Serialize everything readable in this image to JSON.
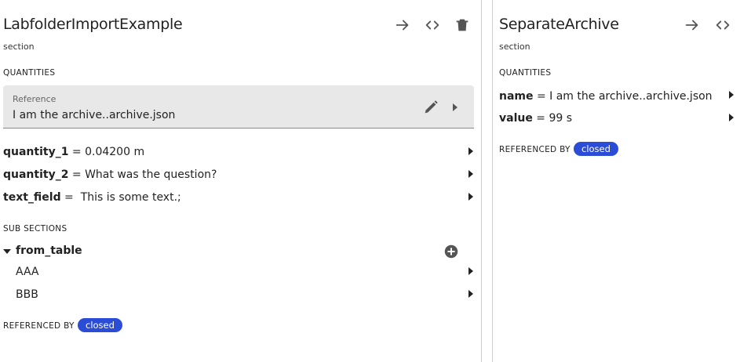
{
  "left_lane": {
    "title": "LabfolderImportExample",
    "subtitle": "section",
    "quantities_heading": "QUANTITIES",
    "reference": {
      "label": "Reference",
      "value": "I am the archive..archive.json"
    },
    "quantities": [
      {
        "name": "quantity_1",
        "equals": " = ",
        "value": "0.04200 m"
      },
      {
        "name": "quantity_2",
        "equals": " = ",
        "value": "What was the question?"
      },
      {
        "name": "text_field",
        "equals": " = ",
        "value": " This is some text.;"
      }
    ],
    "subsections_heading": "SUB SECTIONS",
    "subsection": {
      "name": "from_table",
      "items": [
        "AAA",
        "BBB"
      ]
    },
    "referenced_by_label": "REFERENCED BY",
    "referenced_by_badge": "closed"
  },
  "right_lane": {
    "title": "SeparateArchive",
    "subtitle": "section",
    "quantities_heading": "QUANTITIES",
    "quantities": [
      {
        "name": "name",
        "equals": " = ",
        "value": "I am the archive..archive.json"
      },
      {
        "name": "value",
        "equals": " = ",
        "value": "99 s"
      }
    ],
    "referenced_by_label": "REFERENCED BY",
    "referenced_by_badge": "closed"
  },
  "icons": {
    "navigate": "arrow-right-icon",
    "code": "code-icon",
    "delete": "trash-icon",
    "edit": "pencil-icon",
    "add": "add-circle-icon",
    "expand": "caret-down-icon",
    "open": "caret-right-icon"
  },
  "colors": {
    "badge": "#2a4cd7",
    "reference_box": "#e8e8e8",
    "icon": "#555555"
  }
}
